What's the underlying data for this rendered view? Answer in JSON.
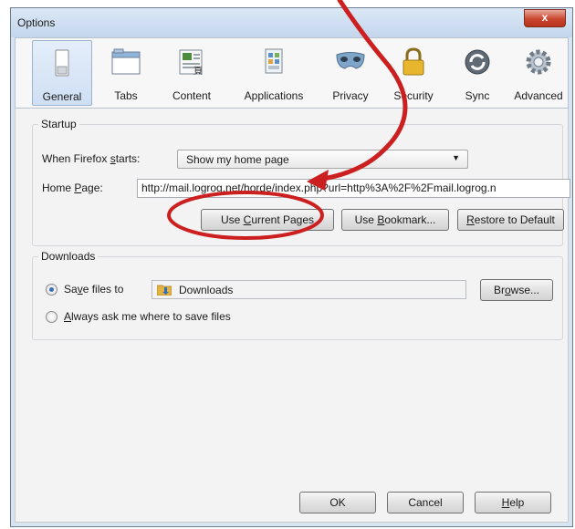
{
  "window": {
    "title": "Options",
    "close_glyph": "x"
  },
  "toolbar": {
    "tabs": [
      {
        "label": "General",
        "icon": "general-switch-icon",
        "selected": true
      },
      {
        "label": "Tabs",
        "icon": "tabs-window-icon",
        "selected": false
      },
      {
        "label": "Content",
        "icon": "content-page-icon",
        "selected": false
      },
      {
        "label": "Applications",
        "icon": "applications-icon",
        "selected": false
      },
      {
        "label": "Privacy",
        "icon": "privacy-mask-icon",
        "selected": false
      },
      {
        "label": "Security",
        "icon": "security-lock-icon",
        "selected": false
      },
      {
        "label": "Sync",
        "icon": "sync-icon",
        "selected": false
      },
      {
        "label": "Advanced",
        "icon": "advanced-gear-icon",
        "selected": false
      }
    ]
  },
  "startup": {
    "legend": "Startup",
    "when_label_pre": "When Firefox ",
    "when_label_ul": "s",
    "when_label_post": "tarts:",
    "when_value": "Show my home page",
    "home_label_pre": "Home ",
    "home_label_ul": "P",
    "home_label_post": "age:",
    "home_value": "http://mail.logrog.net/horde/index.php?url=http%3A%2F%2Fmail.logrog.n",
    "use_current_pre": "Use ",
    "use_current_ul": "C",
    "use_current_post": "urrent Pages",
    "use_bookmark_pre": "Use ",
    "use_bookmark_ul": "B",
    "use_bookmark_post": "ookmark...",
    "restore_pre": "",
    "restore_ul": "R",
    "restore_post": "estore to Default"
  },
  "downloads": {
    "legend": "Downloads",
    "save_pre": "Sa",
    "save_ul": "v",
    "save_post": "e files to",
    "folder": "Downloads",
    "browse_pre": "Br",
    "browse_ul": "o",
    "browse_post": "wse...",
    "ask_pre": "",
    "ask_ul": "A",
    "ask_post": "lways ask me where to save files",
    "save_selected": true
  },
  "footer": {
    "ok": "OK",
    "cancel": "Cancel",
    "help_ul": "H",
    "help_post": "elp"
  },
  "colors": {
    "annotation": "#cc1f1f",
    "radio_dot": "#3b6fb6"
  }
}
